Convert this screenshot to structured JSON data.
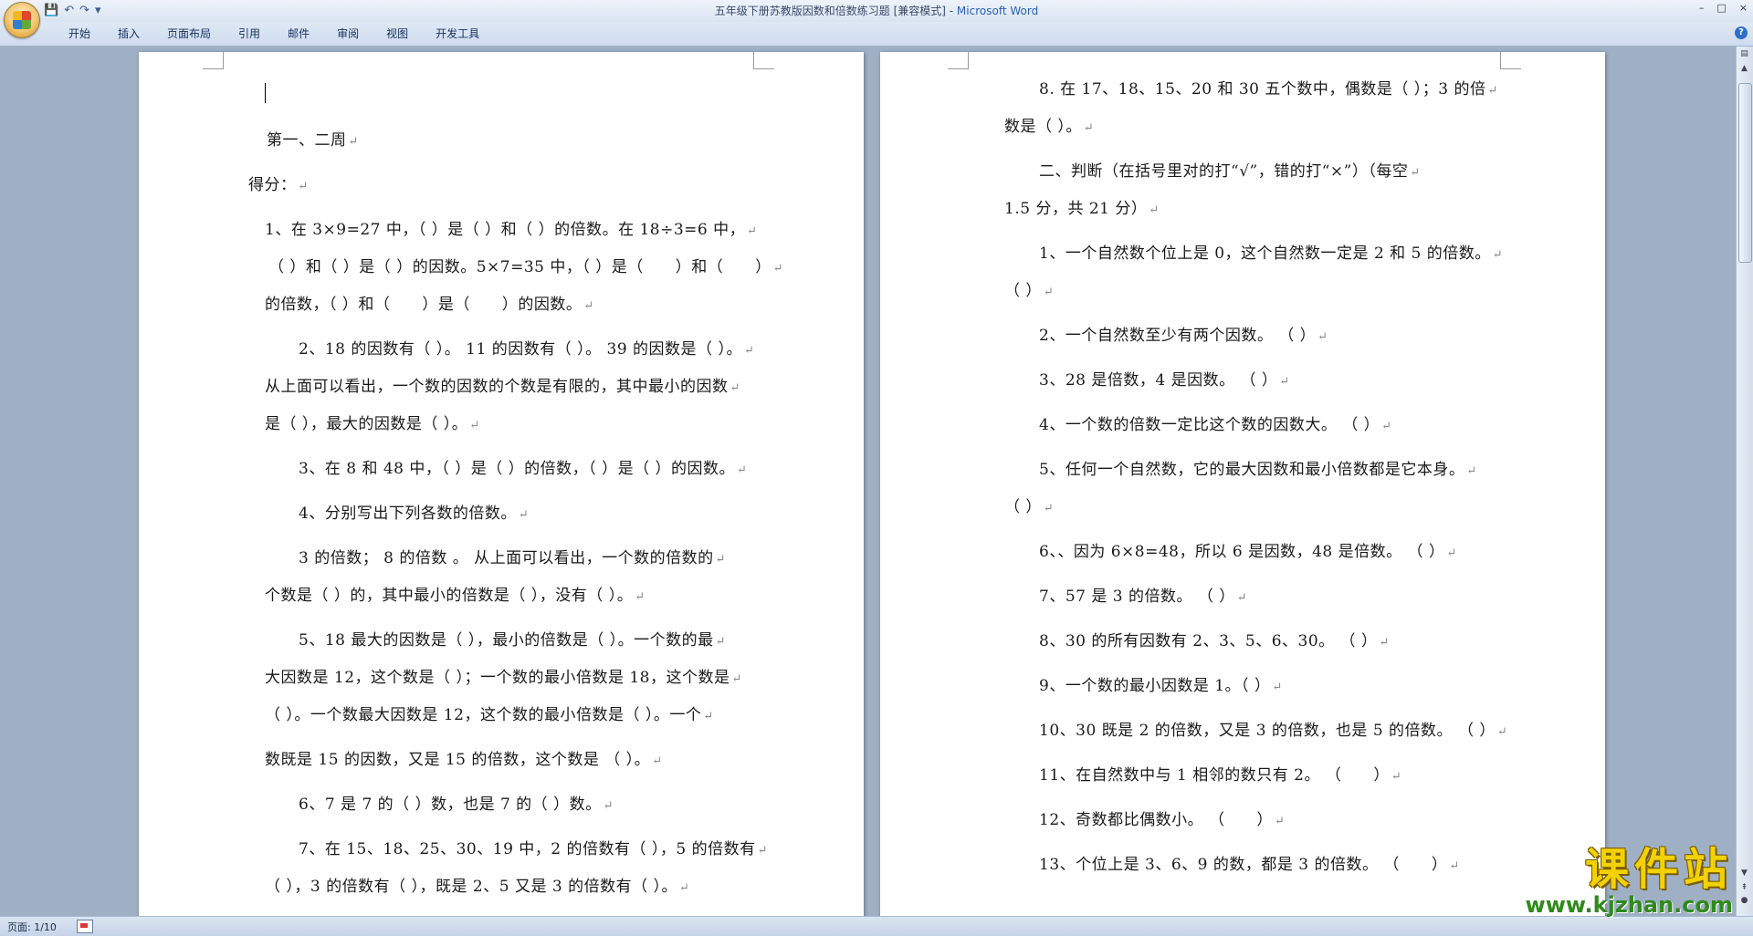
{
  "window": {
    "title": "五年级下册苏教版因数和倍数练习题 [兼容模式] - ",
    "app_name": "Microsoft Word",
    "controls": [
      "–",
      "□",
      "×"
    ]
  },
  "quick_access": {
    "save_icon": "💾",
    "undo_icon": "↶",
    "redo_icon": "↷",
    "customize_icon": "▾"
  },
  "ribbon": {
    "tabs": [
      "开始",
      "插入",
      "页面布局",
      "引用",
      "邮件",
      "审阅",
      "视图",
      "开发工具"
    ],
    "help": "?"
  },
  "document": {
    "left_page": [
      {
        "text": "第一、二周",
        "indent": 0
      },
      {
        "text": "得分：",
        "indent": 0
      },
      {
        "text": "1、在 3×9=27 中，（ ）是（ ）和（ ）的倍数。在 18÷3=6 中，",
        "indent": 0
      },
      {
        "text": "（ ）和（ ）是（ ）的因数。5×7=35 中，（ ）是（　　）和（　　）",
        "indent": 0
      },
      {
        "text": "的倍数，（ ）和（　　）是（　　）的因数。",
        "indent": 0
      },
      {
        "text": "2、18 的因数有（ ）。 11 的因数有（ ）。 39 的因数是（ ）。",
        "indent": 1
      },
      {
        "text": "从上面可以看出，一个数的因数的个数是有限的，其中最小的因数",
        "indent": 0
      },
      {
        "text": "是（ ），最大的因数是（ ）。",
        "indent": 0
      },
      {
        "text": "3、在 8 和 48 中，（ ）是（ ）的倍数，（ ）是（ ）的因数。",
        "indent": 1
      },
      {
        "text": "4、分别写出下列各数的倍数。",
        "indent": 1
      },
      {
        "text": "3 的倍数； 8 的倍数 。 从上面可以看出，一个数的倍数的",
        "indent": 1
      },
      {
        "text": "个数是（ ）的，其中最小的倍数是（ ），没有（ ）。",
        "indent": 0
      },
      {
        "text": "5、18 最大的因数是（ ），最小的倍数是（ ）。一个数的最",
        "indent": 1
      },
      {
        "text": "大因数是 12，这个数是（ ）；一个数的最小倍数是 18，这个数是",
        "indent": 0
      },
      {
        "text": "（ ）。一个数最大因数是 12，这个数的最小倍数是（ ）。一个",
        "indent": 0
      },
      {
        "text": "数既是 15 的因数，又是 15 的倍数，这个数是 （ ）。",
        "indent": 0
      },
      {
        "text": "6、7 是 7 的（ ）数，也是 7 的（ ）数。",
        "indent": 1
      },
      {
        "text": "7、在 15、18、25、30、19 中，2 的倍数有（ ），5 的倍数有",
        "indent": 1
      },
      {
        "text": "（ ），3 的倍数有（ ），既是 2、5 又是 3 的倍数有（ ）。",
        "indent": 0
      }
    ],
    "right_page": [
      {
        "text": "8. 在 17、18、15、20 和 30 五个数中，偶数是（ ）；3 的倍",
        "indent": 1
      },
      {
        "text": "数是（ ）。",
        "indent": 0
      },
      {
        "text": "二、判断（在括号里对的打“√”，错的打“×”）（每空",
        "indent": 1
      },
      {
        "text": "1.5 分，共 21 分）",
        "indent": 0
      },
      {
        "text": "1、一个自然数个位上是 0，这个自然数一定是 2 和 5 的倍数。",
        "indent": 1
      },
      {
        "text": "（ ）",
        "indent": 0
      },
      {
        "text": "2、一个自然数至少有两个因数。 （ ）",
        "indent": 1
      },
      {
        "text": "3、28 是倍数，4 是因数。 （ ）",
        "indent": 1
      },
      {
        "text": "4、一个数的倍数一定比这个数的因数大。 （ ）",
        "indent": 1
      },
      {
        "text": "5、任何一个自然数，它的最大因数和最小倍数都是它本身。",
        "indent": 1
      },
      {
        "text": "（ ）",
        "indent": 0
      },
      {
        "text": "6、、因为 6×8=48，所以 6 是因数，48 是倍数。 （ ）",
        "indent": 1
      },
      {
        "text": "7、57 是 3 的倍数。 （ ）",
        "indent": 1
      },
      {
        "text": "8、30 的所有因数有 2、3、5、6、30。 （ ）",
        "indent": 1
      },
      {
        "text": "9、一个数的最小因数是 1。（ ）",
        "indent": 1
      },
      {
        "text": "10、30 既是 2 的倍数，又是 3 的倍数，也是 5 的倍数。 （ ）",
        "indent": 1
      },
      {
        "text": "11、在自然数中与 1 相邻的数只有 2。 （　　）",
        "indent": 1
      },
      {
        "text": "12、奇数都比偶数小。 （　　）",
        "indent": 1
      },
      {
        "text": "13、个位上是 3、6、9 的数，都是 3 的倍数。 （　　）",
        "indent": 1
      }
    ],
    "paragraph_mark": "↵"
  },
  "status": {
    "page_indicator": "页面: 1/10"
  },
  "watermark": {
    "brand": "课件站",
    "url": "www.kjzhan.com"
  },
  "colors": {
    "workspace": "#9fb0c4",
    "app_name": "#2a5fb5",
    "watermark_text": "#f2d200",
    "watermark_url": "#2f8a1b"
  }
}
